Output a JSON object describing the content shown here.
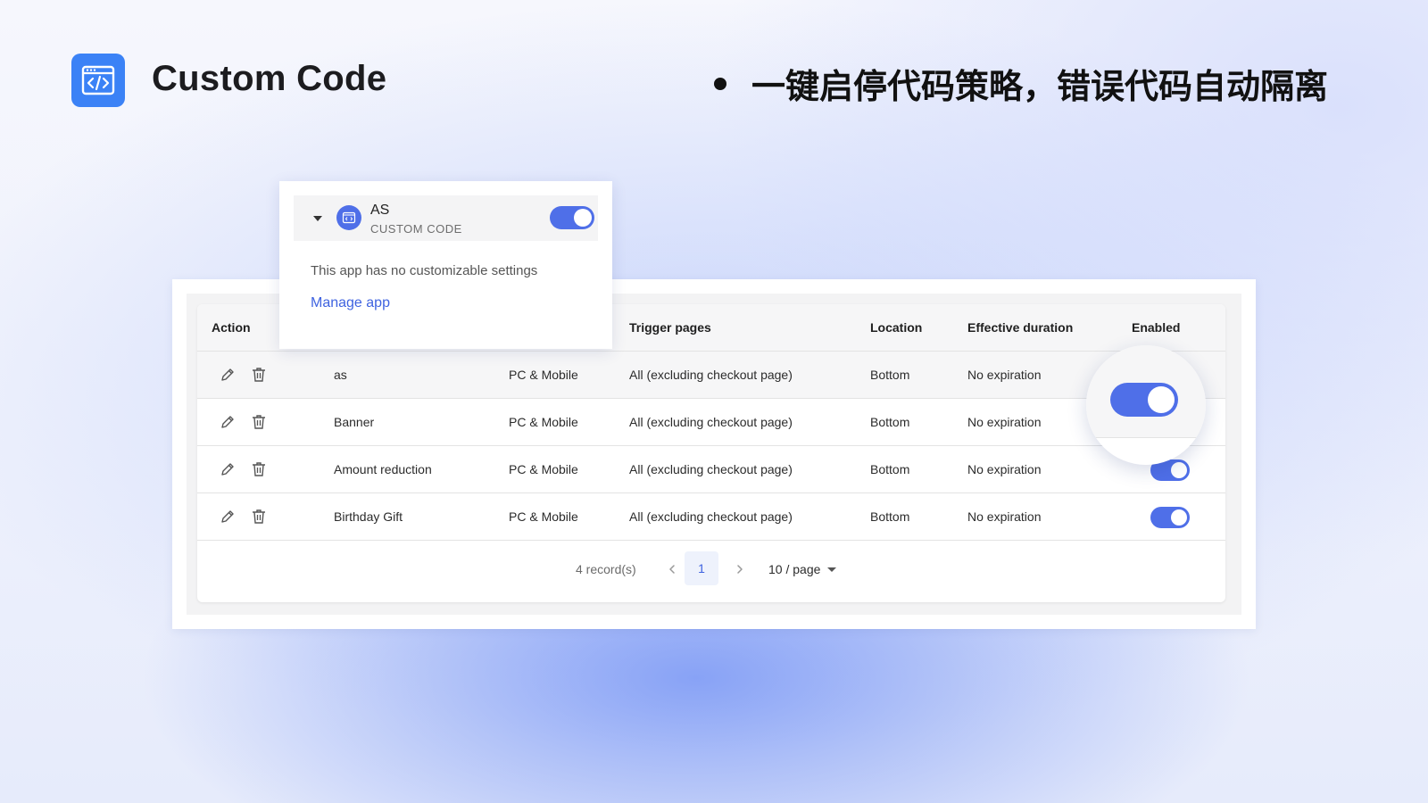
{
  "header": {
    "logo_icon": "code-window-icon",
    "title": "Custom Code",
    "headline": "一键启停代码策略，错误代码自动隔离"
  },
  "app_card": {
    "name": "AS",
    "subtitle": "CUSTOM CODE",
    "enabled": true,
    "description": "This app has no customizable settings",
    "manage_link": "Manage app"
  },
  "table": {
    "columns": {
      "action": "Action",
      "trigger_pages": "Trigger pages",
      "location": "Location",
      "effective_duration": "Effective duration",
      "enabled": "Enabled"
    },
    "rows": [
      {
        "name": "as",
        "platform": "PC & Mobile",
        "trigger": "All (excluding checkout page)",
        "location": "Bottom",
        "duration": "No expiration",
        "enabled": true
      },
      {
        "name": "Banner",
        "platform": "PC & Mobile",
        "trigger": "All (excluding checkout page)",
        "location": "Bottom",
        "duration": "No expiration",
        "enabled": true
      },
      {
        "name": "Amount reduction",
        "platform": "PC & Mobile",
        "trigger": "All (excluding checkout page)",
        "location": "Bottom",
        "duration": "No expiration",
        "enabled": true
      },
      {
        "name": "Birthday Gift",
        "platform": "PC & Mobile",
        "trigger": "All (excluding checkout page)",
        "location": "Bottom",
        "duration": "No expiration",
        "enabled": true
      }
    ]
  },
  "pagination": {
    "records": "4 record(s)",
    "current_page": "1",
    "per_page": "10 / page"
  },
  "colors": {
    "accent": "#4f6fe8",
    "logo_bg": "#3b82f6",
    "link": "#3f63e0"
  }
}
